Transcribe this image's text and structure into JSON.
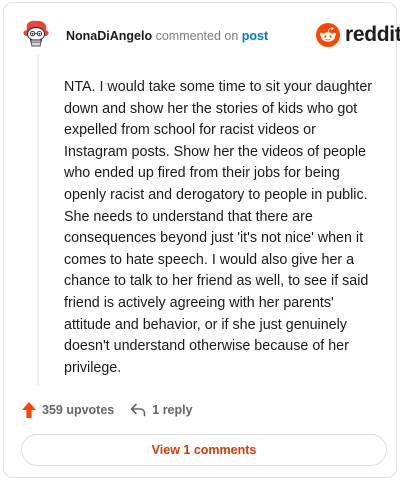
{
  "comment": {
    "username": "NonaDiAngelo",
    "meta_text": "commented on",
    "post_link": "post",
    "body": "NTA. I would take some time to sit your daughter down and show her the stories of kids who got expelled from school for racist videos or Instagram posts. Show her the videos of people who ended up fired from their jobs for being openly racist and derogatory to people in public. She needs to understand that there are consequences beyond just 'it's not nice' when it comes to hate speech. I would also give her a chance to talk to her friend as well, to see if said friend is actively agreeing with her parents' attitude and behavior, or if she just genuinely doesn't understand otherwise because of her privilege."
  },
  "brand": {
    "name": "reddit",
    "icon": "reddit-logo-icon",
    "color": "#ff4500"
  },
  "actions": {
    "upvotes_label": "359 upvotes",
    "upvote_icon": "upvote-arrow-icon",
    "upvote_color": "#ff4500",
    "reply_label": "1 reply",
    "reply_icon": "reply-arrow-icon"
  },
  "footer": {
    "view_comments_label": "View 1 comments",
    "accent_color": "#d93a00"
  }
}
